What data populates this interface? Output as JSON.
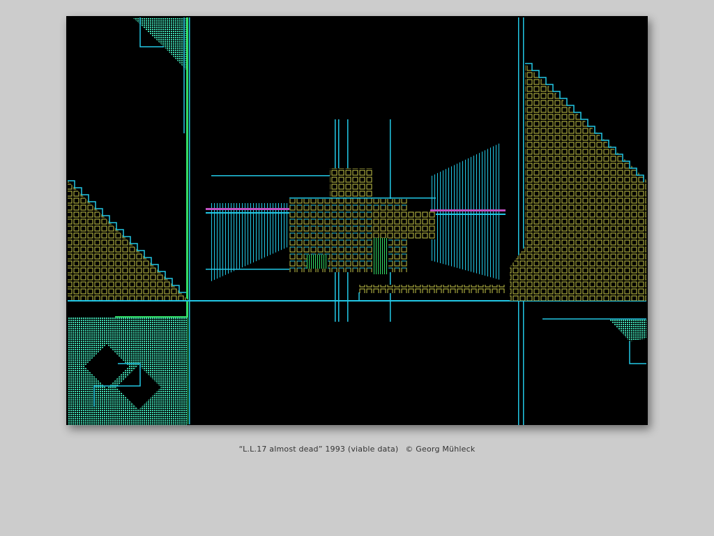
{
  "caption": {
    "title": "“L.L.17 almost dead” 1993 (viable data)",
    "copyright": "© Georg Mühleck"
  },
  "artwork": {
    "background_color": "#000000",
    "palette": {
      "cyan": "#22c8e6",
      "teal": "#3fd9b0",
      "green": "#33dd66",
      "yellow": "#c8c84a",
      "magenta": "#c050c0"
    }
  }
}
